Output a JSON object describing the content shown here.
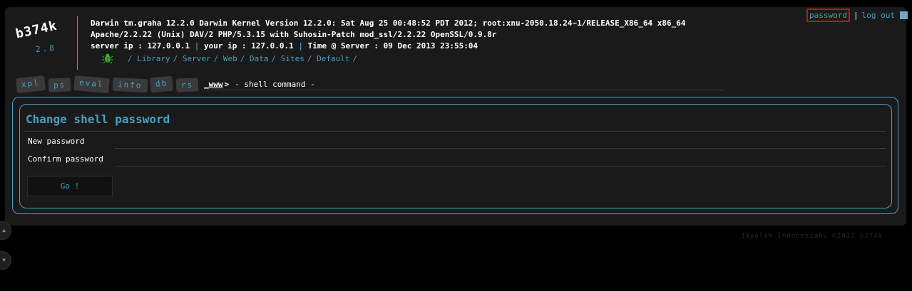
{
  "logo": {
    "name": "b374k",
    "version": "2.8"
  },
  "sysinfo": {
    "line1": "Darwin tm.graha 12.2.0 Darwin Kernel Version 12.2.0: Sat Aug 25 00:48:52 PDT 2012; root:xnu-2050.18.24~1/RELEASE_X86_64 x86_64",
    "line2": "Apache/2.2.22 (Unix) DAV/2 PHP/5.3.15 with Suhosin-Patch mod_ssl/2.2.22 OpenSSL/0.9.8r",
    "server_ip": "server ip : 127.0.0.1",
    "your_ip": "your ip : 127.0.0.1",
    "time": "Time @ Server : 09 Dec 2013 23:55:04",
    "separator": "|"
  },
  "path": [
    "/ Library",
    "/ Server",
    "/ Web",
    "/ Data",
    "/ Sites",
    "/ Default",
    "/"
  ],
  "topright": {
    "password": "password",
    "separator": "|",
    "logout": "log out"
  },
  "tabs": [
    "xpl",
    "ps",
    "eval",
    "info",
    "db",
    "rs"
  ],
  "command": {
    "prompt": "_www",
    "arrow": ">",
    "placeholder": "- shell command -"
  },
  "form": {
    "title": "Change shell password",
    "new_password_label": "New password",
    "confirm_password_label": "Confirm password",
    "submit_label": "Go !"
  },
  "footer": "Jayalah Indonesiaku ©2013 b374k",
  "colors": {
    "accent": "#4a9fc0",
    "panel": "#1a1a1a",
    "highlight_border": "#d01010"
  },
  "icons": {
    "path_icon": "bug-icon",
    "logout_icon": "square-icon"
  }
}
